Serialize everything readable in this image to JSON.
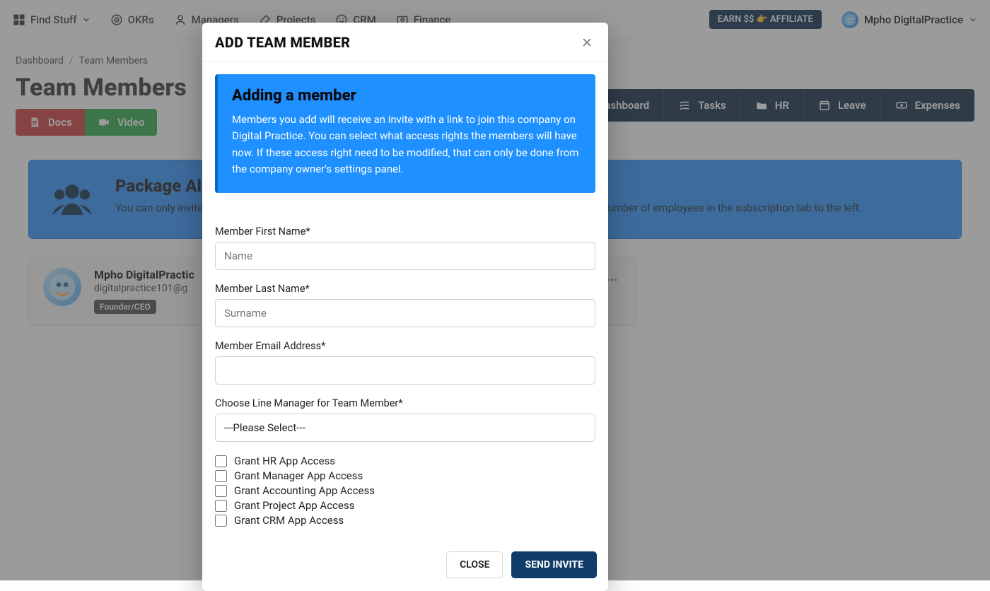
{
  "topnav": {
    "find_stuff": "Find Stuff",
    "items": [
      {
        "label": "OKRs"
      },
      {
        "label": "Managers"
      },
      {
        "label": "Projects"
      },
      {
        "label": "CRM"
      },
      {
        "label": "Finance"
      }
    ],
    "affiliate": "EARN $$ 👉 AFFILIATE",
    "user_name": "Mpho DigitalPractice"
  },
  "breadcrumb": {
    "root": "Dashboard",
    "current": "Team Members"
  },
  "page_title": "Team Members",
  "buttons": {
    "docs": "Docs",
    "video": "Video"
  },
  "tabs": [
    {
      "label": "Dashboard"
    },
    {
      "label": "Tasks"
    },
    {
      "label": "HR"
    },
    {
      "label": "Leave"
    },
    {
      "label": "Expenses"
    }
  ],
  "banner": {
    "title": "Package Allo",
    "text_left": "You can only invite",
    "text_right": "e the number of employees in the subscription tab to the left."
  },
  "member_card": {
    "name": "Mpho DigitalPractic",
    "email": "digitalpractice101@g",
    "role": "Founder/CEO"
  },
  "modal": {
    "title": "ADD TEAM MEMBER",
    "info_title": "Adding a member",
    "info_text": "Members you add will receive an invite with a link to join this company on Digital Practice. You can select what access rights the members will have now. If these access right need to be modified, that can only be done from the company owner's settings panel.",
    "labels": {
      "first": "Member First Name*",
      "last": "Member Last Name*",
      "email": "Member Email Address*",
      "manager": "Choose Line Manager for Team Member*"
    },
    "placeholders": {
      "first": "Name",
      "last": "Surname"
    },
    "manager_default": "---Please Select---",
    "checks": [
      "Grant HR App Access",
      "Grant Manager App Access",
      "Grant Accounting App Access",
      "Grant Project App Access",
      "Grant CRM App Access"
    ],
    "footer": {
      "close": "CLOSE",
      "send": "SEND INVITE"
    }
  }
}
